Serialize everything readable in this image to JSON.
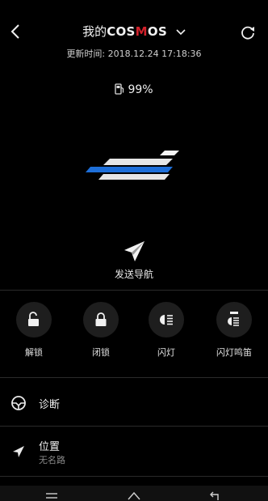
{
  "header": {
    "title_prefix": "我的",
    "brand_main": "COS",
    "brand_accent": "M",
    "brand_tail": "OS",
    "update_label": "更新时间:",
    "update_time": "2018.12.24 17:18:36"
  },
  "fuel": {
    "value": "99%",
    "icon": "fuel-pump-icon"
  },
  "send_nav": {
    "label": "发送导航",
    "icon": "paper-plane-icon"
  },
  "actions": [
    {
      "label": "解锁",
      "icon": "unlock-icon"
    },
    {
      "label": "闭锁",
      "icon": "lock-icon"
    },
    {
      "label": "闪灯",
      "icon": "headlight-icon"
    },
    {
      "label": "闪灯鸣笛",
      "icon": "horn-light-icon"
    }
  ],
  "list": [
    {
      "title": "诊断",
      "icon": "steering-wheel-icon"
    },
    {
      "title": "位置",
      "subtitle": "无名路",
      "icon": "location-arrow-icon"
    }
  ],
  "colors": {
    "background": "#000000",
    "brand_accent": "#d0202a",
    "logo_blue": "#1e6fd9"
  }
}
